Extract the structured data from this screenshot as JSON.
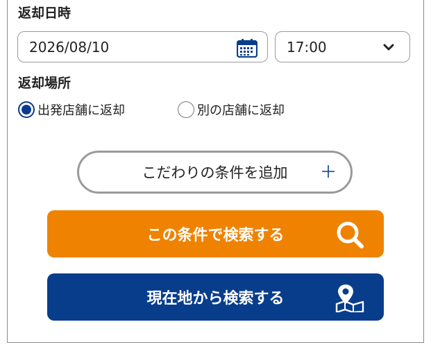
{
  "return_datetime": {
    "heading": "返却日時",
    "date_value": "2026/08/10",
    "time_value": "17:00"
  },
  "return_place": {
    "heading": "返却場所",
    "options": [
      {
        "label": "出発店舗に返却",
        "selected": true
      },
      {
        "label": "別の店舗に返却",
        "selected": false
      }
    ]
  },
  "buttons": {
    "add_conditions": "こだわりの条件を追加",
    "search": "この条件で検索する",
    "search_nearby": "現在地から検索する"
  },
  "colors": {
    "accent_blue": "#083d8c",
    "search_orange": "#ef8200"
  },
  "icons": {
    "date": "calendar-icon",
    "time": "chevron-down-icon",
    "add": "plus-icon",
    "search": "magnifier-icon",
    "nearby": "map-pin-icon"
  }
}
